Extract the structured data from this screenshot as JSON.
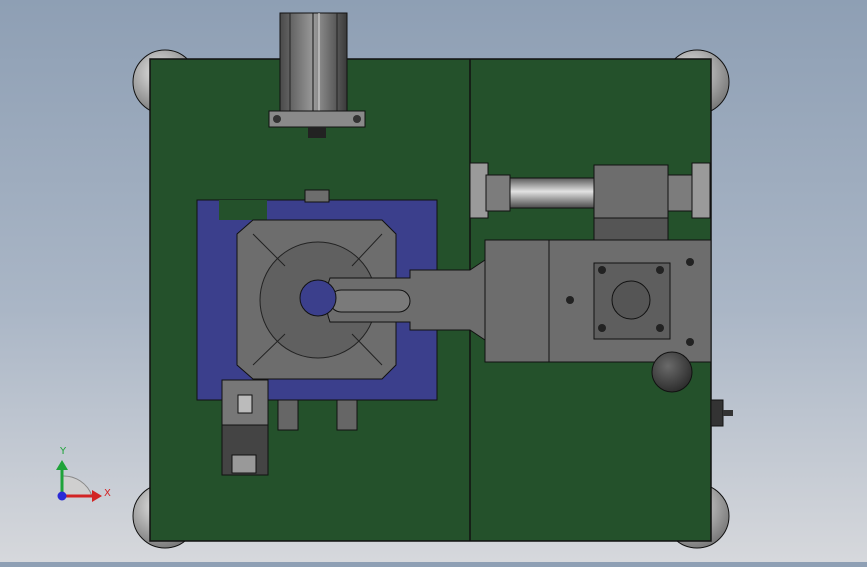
{
  "viewport": {
    "background_top": "#8e9fb4",
    "background_bottom": "#d6d8dc"
  },
  "colors": {
    "base_plate": "#24512b",
    "fixture_plate": "#3b3f8c",
    "steel": "#6d6d6d",
    "dark_steel": "#333333",
    "light_steel": "#c8c8c8",
    "outline": "#111111"
  },
  "triad": {
    "y_label": "Y",
    "x_label": "X",
    "y_color": "#1fa33a",
    "x_color": "#d22424",
    "z_color": "#2a2ad6"
  }
}
